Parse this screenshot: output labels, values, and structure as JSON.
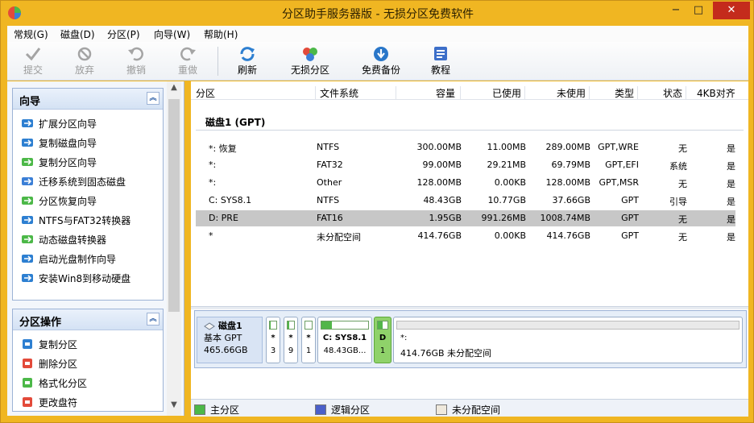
{
  "window": {
    "title": "分区助手服务器版 - 无损分区免费软件",
    "min": "−",
    "max": "□",
    "close": "✕"
  },
  "menu": [
    "常规(G)",
    "磁盘(D)",
    "分区(P)",
    "向导(W)",
    "帮助(H)"
  ],
  "toolbar": [
    {
      "label": "提交",
      "icon": "check-icon",
      "enabled": false
    },
    {
      "label": "放弃",
      "icon": "discard-icon",
      "enabled": false
    },
    {
      "label": "撤销",
      "icon": "undo-icon",
      "enabled": false
    },
    {
      "label": "重做",
      "icon": "redo-icon",
      "enabled": false
    },
    {
      "label": "刷新",
      "icon": "refresh-icon",
      "enabled": true
    },
    {
      "label": "无损分区",
      "icon": "partition-icon",
      "enabled": true
    },
    {
      "label": "免费备份",
      "icon": "backup-icon",
      "enabled": true
    },
    {
      "label": "教程",
      "icon": "tutorial-icon",
      "enabled": true
    }
  ],
  "wizard_panel": {
    "title": "向导",
    "items": [
      "扩展分区向导",
      "复制磁盘向导",
      "复制分区向导",
      "迁移系统到固态磁盘",
      "分区恢复向导",
      "NTFS与FAT32转换器",
      "动态磁盘转换器",
      "启动光盘制作向导",
      "安装Win8到移动硬盘"
    ]
  },
  "ops_panel": {
    "title": "分区操作",
    "items": [
      "复制分区",
      "删除分区",
      "格式化分区",
      "更改盘符"
    ]
  },
  "table": {
    "headers": [
      "分区",
      "文件系统",
      "容量",
      "已使用",
      "未使用",
      "类型",
      "状态",
      "4KB对齐"
    ],
    "disk_label": "磁盘1 (GPT)",
    "rows": [
      {
        "part": "*: 恢复",
        "fs": "NTFS",
        "cap": "300.00MB",
        "used": "11.00MB",
        "free": "289.00MB",
        "type": "GPT,WRE",
        "status": "无",
        "align": "是"
      },
      {
        "part": "*:",
        "fs": "FAT32",
        "cap": "99.00MB",
        "used": "29.21MB",
        "free": "69.79MB",
        "type": "GPT,EFI",
        "status": "系统",
        "align": "是"
      },
      {
        "part": "*:",
        "fs": "Other",
        "cap": "128.00MB",
        "used": "0.00KB",
        "free": "128.00MB",
        "type": "GPT,MSR",
        "status": "无",
        "align": "是"
      },
      {
        "part": "C: SYS8.1",
        "fs": "NTFS",
        "cap": "48.43GB",
        "used": "10.77GB",
        "free": "37.66GB",
        "type": "GPT",
        "status": "引导",
        "align": "是"
      },
      {
        "part": "D: PRE",
        "fs": "FAT16",
        "cap": "1.95GB",
        "used": "991.26MB",
        "free": "1008.74MB",
        "type": "GPT",
        "status": "无",
        "align": "是",
        "selected": true
      },
      {
        "part": "*",
        "fs": "未分配空间",
        "cap": "414.76GB",
        "used": "0.00KB",
        "free": "414.76GB",
        "type": "GPT",
        "status": "无",
        "align": "是"
      }
    ]
  },
  "disk_map": {
    "name": "磁盘1",
    "kind": "基本 GPT",
    "size": "465.66GB",
    "blocks": [
      {
        "t1": "*",
        "t2": "3",
        "usage": 0.04
      },
      {
        "t1": "*",
        "t2": "9",
        "usage": 0.3
      },
      {
        "t1": "*",
        "t2": "1",
        "usage": 0.0
      },
      {
        "t1": "C: SYS8.1",
        "t2": "48.43GB...",
        "usage": 0.22
      },
      {
        "t1": "D",
        "t2": "1",
        "usage": 0.5,
        "selected": true
      },
      {
        "t1": "*:",
        "t2": "414.76GB 未分配空间",
        "usage": 0.0,
        "unalloc": true
      }
    ]
  },
  "legend": [
    {
      "label": "主分区",
      "color": "#4cb848"
    },
    {
      "label": "逻辑分区",
      "color": "#4a5fc9"
    },
    {
      "label": "未分配空间",
      "color": "#efe9dc"
    }
  ]
}
